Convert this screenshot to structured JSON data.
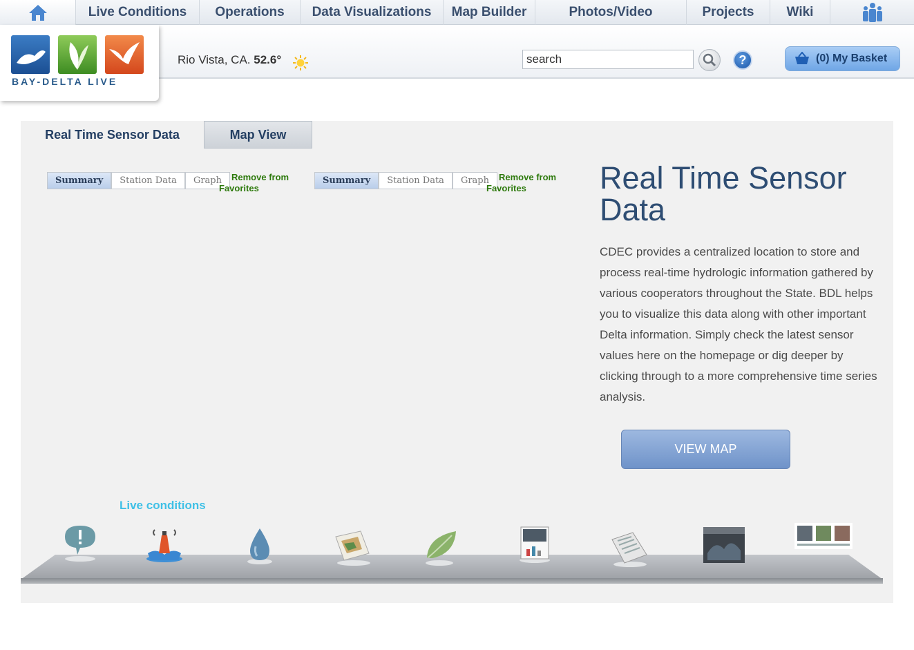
{
  "nav": {
    "items": [
      {
        "id": "live-conditions",
        "label": "Live Conditions"
      },
      {
        "id": "operations",
        "label": "Operations"
      },
      {
        "id": "data-visualizations",
        "label": "Data Visualizations"
      },
      {
        "id": "map-builder",
        "label": "Map Builder"
      },
      {
        "id": "photos-video",
        "label": "Photos/Video"
      },
      {
        "id": "projects",
        "label": "Projects"
      },
      {
        "id": "wiki",
        "label": "Wiki"
      }
    ],
    "home_icon": "home-icon",
    "people_icon": "people-icon"
  },
  "header": {
    "logo_text": "BAY-DELTA LIVE",
    "location": "Rio Vista, CA.",
    "temperature": "52.6°",
    "weather_icon": "sun-icon",
    "search": {
      "value": "search"
    },
    "basket_label": "(0) My Basket"
  },
  "tabs": {
    "realtime": "Real Time Sensor Data",
    "map": "Map View"
  },
  "widgets": [
    {
      "subtabs": [
        "Summary",
        "Station Data",
        "Graph"
      ],
      "active": 0,
      "remove_line1": "Remove from",
      "remove_line2": "Favorites"
    },
    {
      "subtabs": [
        "Summary",
        "Station Data",
        "Graph"
      ],
      "active": 0,
      "remove_line1": "Remove from",
      "remove_line2": "Favorites"
    }
  ],
  "content": {
    "title": "Real Time Sensor Data",
    "description": "CDEC provides a centralized location to store and process real-time hydrologic information gathered by various cooperators throughout the State. BDL helps you to visualize this data along with other important Delta information. Simply check the latest sensor values here on the homepage or dig deeper by clicking through to a more comprehensive time series analysis.",
    "view_map_label": "VIEW MAP"
  },
  "dock": {
    "hover_label": "Live conditions",
    "items": [
      "alert-icon",
      "buoy-icon",
      "water-drop-icon",
      "map-icon",
      "leaf-icon",
      "photos-icon",
      "news-icon",
      "image-icon",
      "logo-icon"
    ]
  },
  "colors": {
    "nav_text": "#3a4f6e",
    "title": "#2e4d73",
    "favorites_green": "#2e7a0d",
    "live_blue": "#3fc0e6"
  }
}
